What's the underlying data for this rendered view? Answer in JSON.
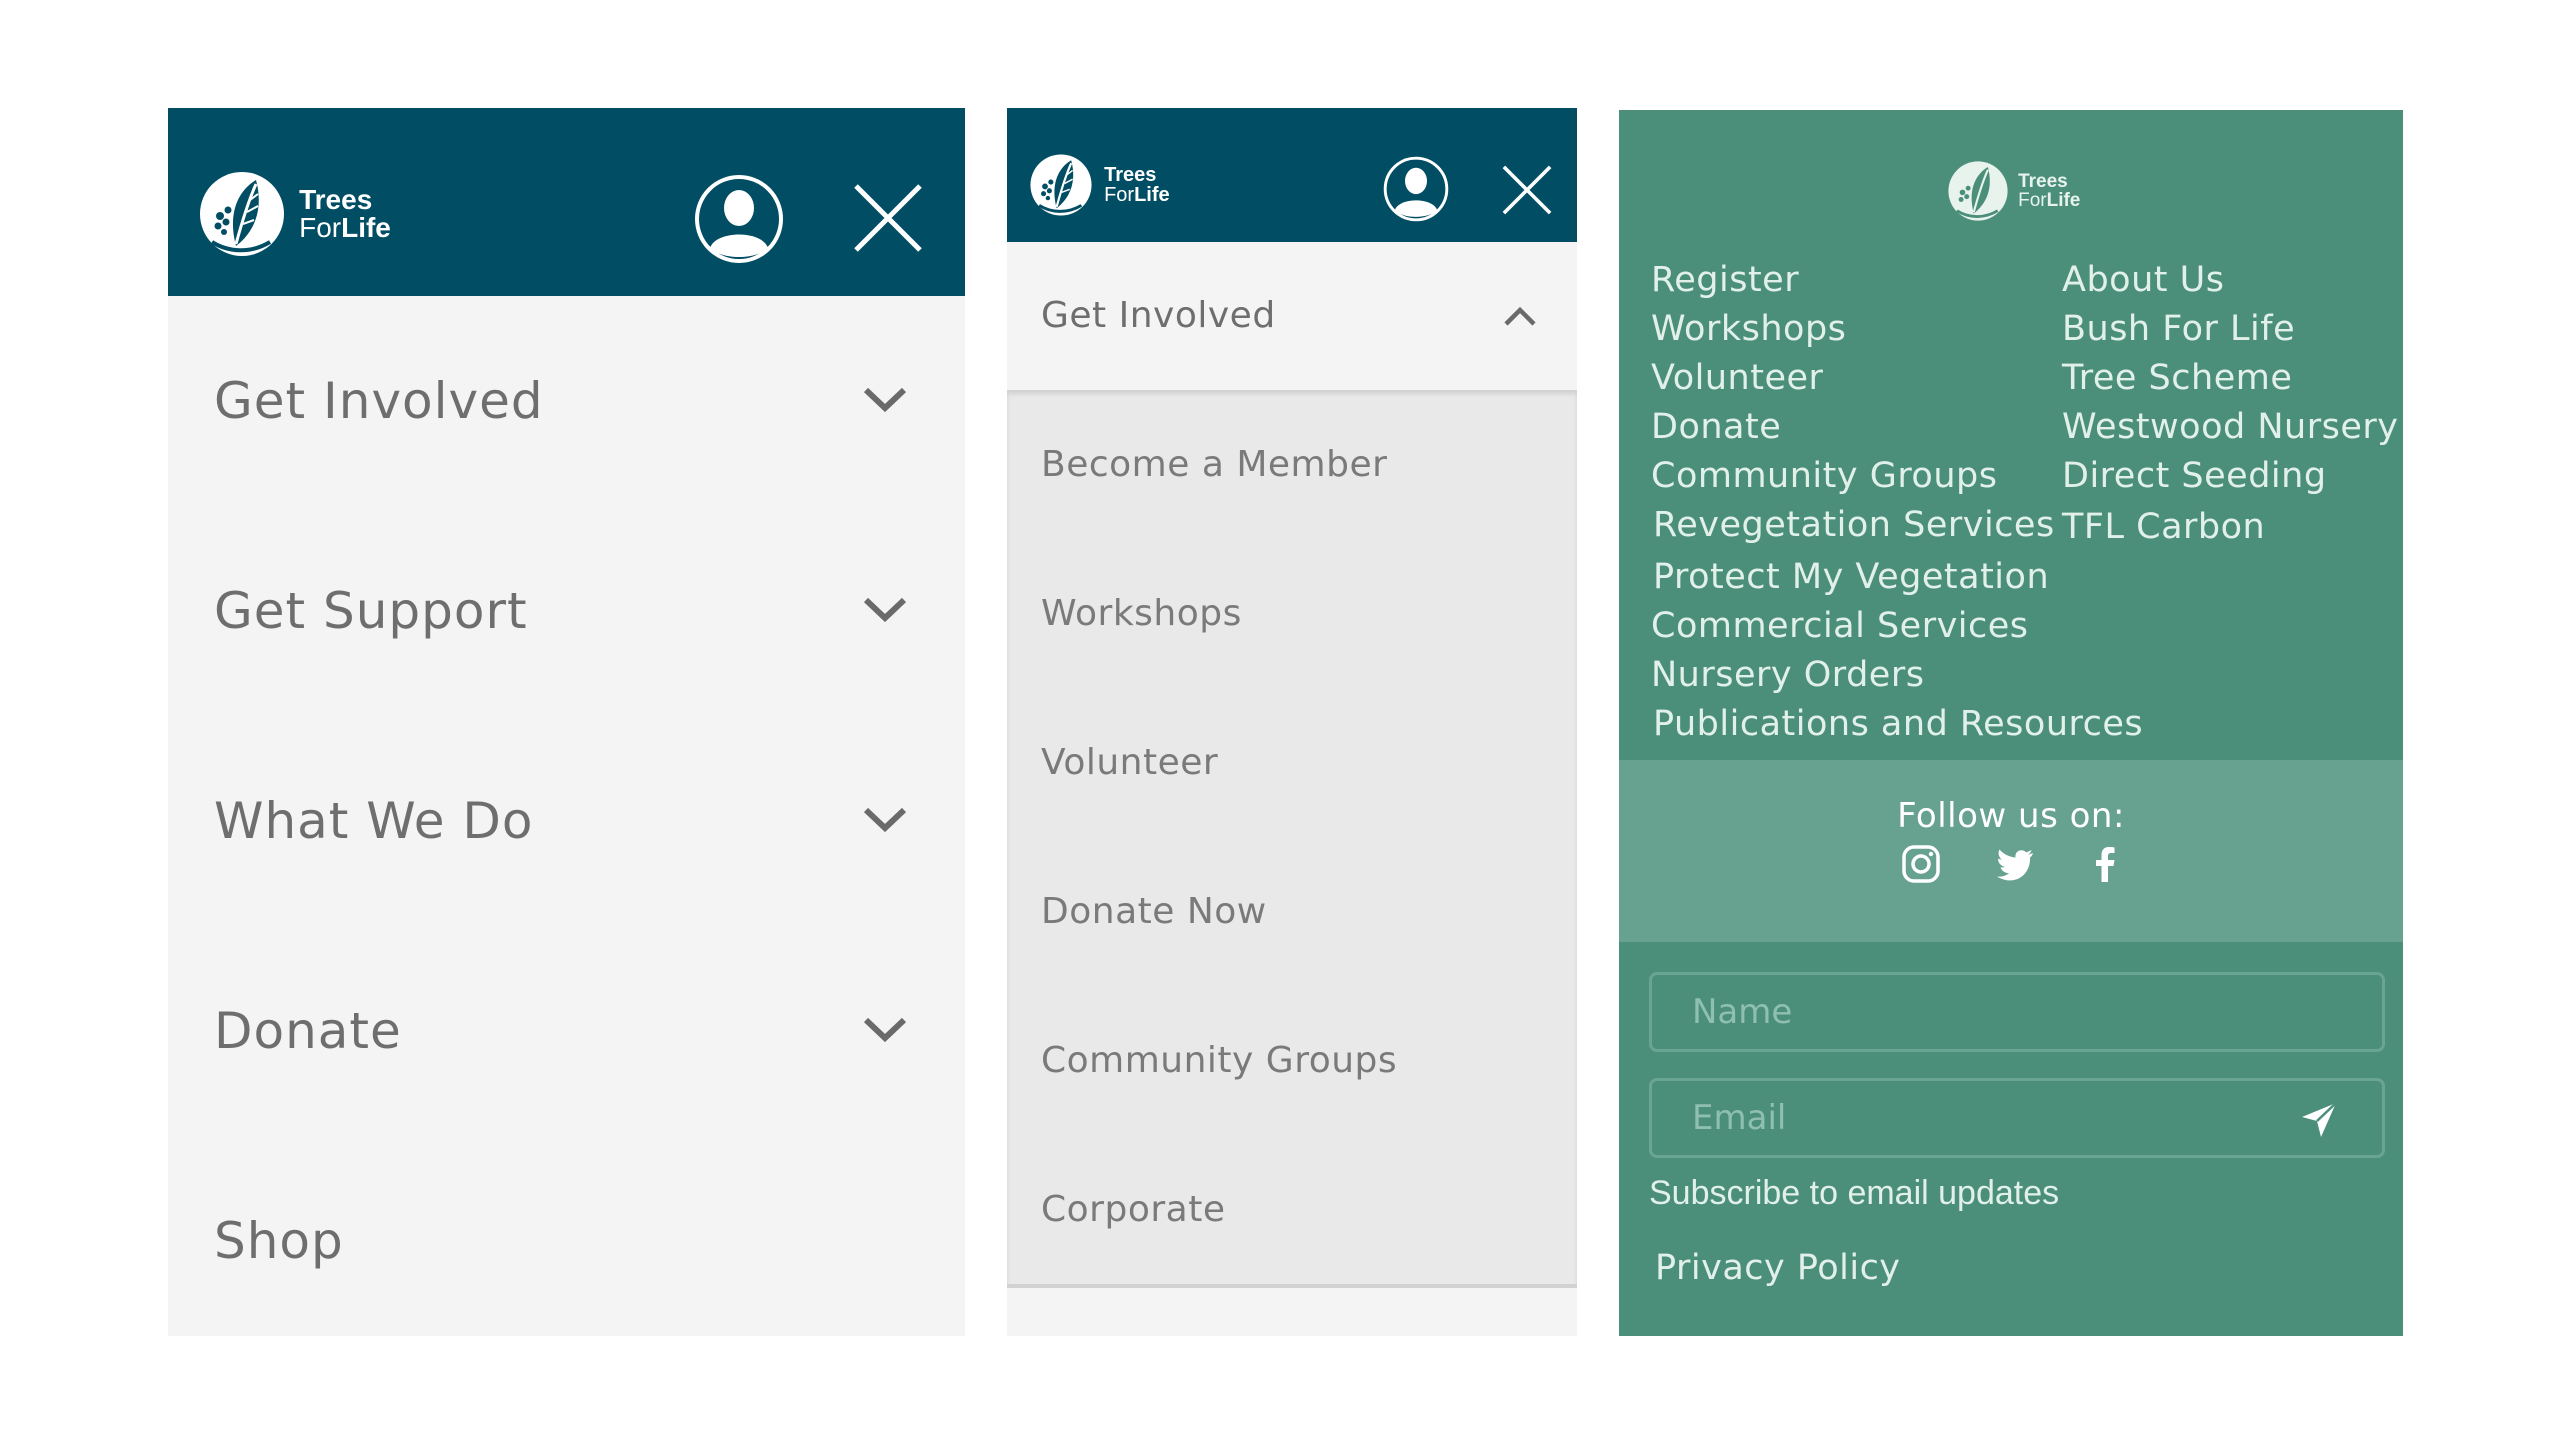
{
  "brand": {
    "name_line1": "Trees",
    "name_line2_light": "For",
    "name_line2_bold": "Life"
  },
  "colors": {
    "header": "#014d64",
    "menu_bg": "#f4f4f4",
    "submenu_bg": "#e9e9e9",
    "footer_bg": "#4b8f7a",
    "follow_bg": "#67a291"
  },
  "icons": {
    "account": "user-circle-icon",
    "close": "close-icon",
    "expand": "chevron-down-icon",
    "collapse": "chevron-up-icon",
    "send": "send-icon",
    "instagram": "instagram-icon",
    "twitter": "twitter-icon",
    "facebook": "facebook-icon"
  },
  "main_menu": {
    "items": [
      {
        "label": "Get Involved",
        "expandable": true
      },
      {
        "label": "Get Support",
        "expandable": true
      },
      {
        "label": "What We Do",
        "expandable": true
      },
      {
        "label": "Donate",
        "expandable": true
      },
      {
        "label": "Shop",
        "expandable": false
      }
    ]
  },
  "expanded_menu": {
    "open_item": "Get Involved",
    "sub_items": [
      "Become a Member",
      "Workshops",
      "Volunteer",
      "Donate Now",
      "Community Groups",
      "Corporate"
    ]
  },
  "footer": {
    "left_links": [
      "Register",
      "Workshops",
      "Volunteer",
      "Donate",
      "Community Groups",
      "Revegetation Services",
      "Protect My Vegetation",
      "Commercial Services",
      "Nursery Orders",
      "Publications and Resources"
    ],
    "right_links": [
      "About Us",
      "Bush For Life",
      "Tree Scheme",
      "Westwood Nursery",
      "Direct Seeding",
      "TFL Carbon"
    ],
    "follow_title": "Follow us on:",
    "name_placeholder": "Name",
    "email_placeholder": "Email",
    "subscribe_text": "Subscribe to email updates",
    "privacy_label": "Privacy Policy"
  }
}
